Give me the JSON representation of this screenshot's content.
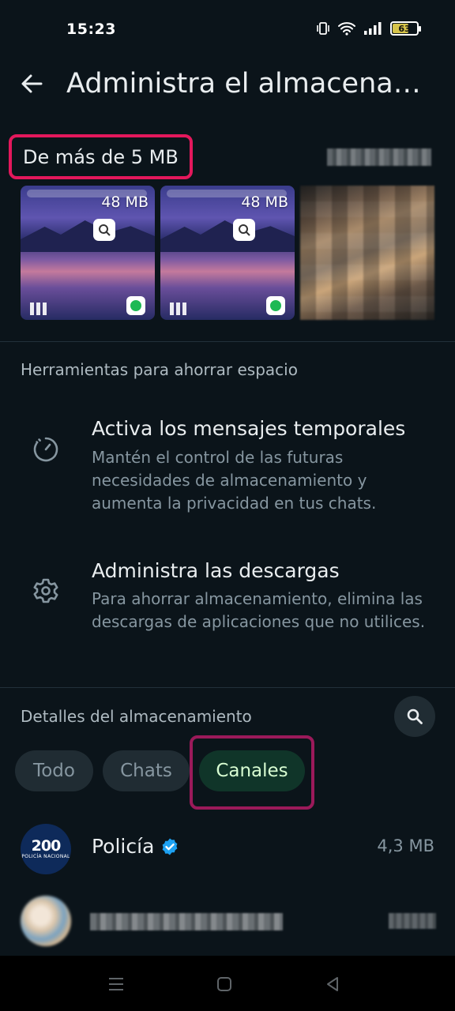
{
  "status_bar": {
    "time": "15:23",
    "battery_level": "63",
    "battery_fraction": 0.63,
    "icons": [
      "vibrate-icon",
      "wifi-icon",
      "signal-icon",
      "battery-icon"
    ]
  },
  "app_bar": {
    "title": "Administra el almacenamiento",
    "back_icon": "arrow-left-icon"
  },
  "large_files": {
    "heading": "De más de 5 MB",
    "items": [
      {
        "size": "48 MB"
      },
      {
        "size": "48 MB"
      }
    ]
  },
  "tools": {
    "heading": "Herramientas para ahorrar espacio",
    "items": [
      {
        "icon": "disappearing-timer-icon",
        "title": "Activa los mensajes temporales",
        "description": "Mantén el control de las futuras necesidades de almacenamiento y aumenta la privacidad en tus chats."
      },
      {
        "icon": "gear-icon",
        "title": "Administra las descargas",
        "description": "Para ahorrar almacenamiento, elimina las descargas de aplicaciones que no utilices."
      }
    ]
  },
  "details": {
    "heading": "Detalles del almacenamiento",
    "search_icon": "search-icon",
    "filters": [
      {
        "label": "Todo",
        "active": false
      },
      {
        "label": "Chats",
        "active": false
      },
      {
        "label": "Canales",
        "active": true
      }
    ],
    "channels": [
      {
        "name": "Policía",
        "verified": true,
        "size": "4,3 MB",
        "avatar_text": "200",
        "avatar_org": "POLICÍA NACIONAL"
      }
    ]
  },
  "nav_bar": {
    "buttons": [
      "menu-icon",
      "home-icon",
      "back-triangle-icon"
    ]
  },
  "colors": {
    "background": "#0b141a",
    "accent_green": "#103529",
    "highlight_pink": "#e3185c",
    "highlight_magenta": "#9b1a5a",
    "verified_blue": "#1da1f2"
  }
}
